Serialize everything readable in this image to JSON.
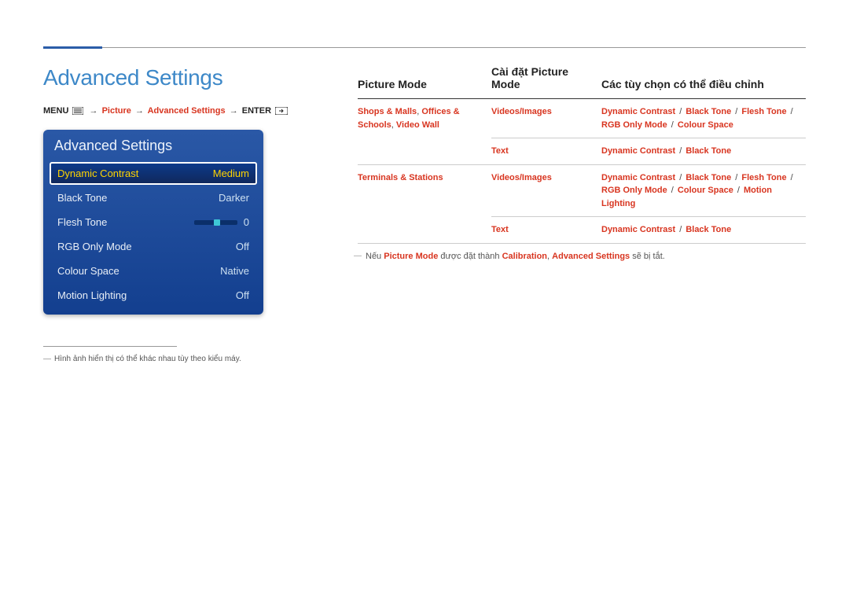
{
  "section_title": "Advanced Settings",
  "breadcrumb": {
    "menu_label": "MENU",
    "picture": "Picture",
    "advanced_settings": "Advanced Settings",
    "enter_label": "ENTER",
    "arrow": "→"
  },
  "osd": {
    "title": "Advanced Settings",
    "items": [
      {
        "label": "Dynamic Contrast",
        "value": "Medium",
        "selected": true,
        "has_slider": false
      },
      {
        "label": "Black Tone",
        "value": "Darker",
        "selected": false,
        "has_slider": false
      },
      {
        "label": "Flesh Tone",
        "value": "0",
        "selected": false,
        "has_slider": true
      },
      {
        "label": "RGB Only Mode",
        "value": "Off",
        "selected": false,
        "has_slider": false
      },
      {
        "label": "Colour Space",
        "value": "Native",
        "selected": false,
        "has_slider": false
      },
      {
        "label": "Motion Lighting",
        "value": "Off",
        "selected": false,
        "has_slider": false
      }
    ]
  },
  "footnote_left": "Hình ảnh hiển thị có thể khác nhau tùy theo kiểu máy.",
  "table": {
    "headers": {
      "picture_mode": "Picture Mode",
      "setting": "Cài đặt Picture Mode",
      "adjustable": "Các tùy chọn có thể điều chỉnh"
    },
    "rows": [
      {
        "picture_mode_parts": [
          "Shops & Malls",
          ", ",
          "Offices & Schools",
          ", ",
          "Video Wall"
        ],
        "rowspan": 2,
        "setting": "Videos/Images",
        "options": [
          "Dynamic Contrast",
          "Black Tone",
          "Flesh Tone",
          "RGB Only Mode",
          "Colour Space"
        ]
      },
      {
        "picture_mode_parts": null,
        "setting": "Text",
        "options": [
          "Dynamic Contrast",
          "Black Tone"
        ]
      },
      {
        "picture_mode_parts": [
          "Terminals & Stations"
        ],
        "rowspan": 2,
        "setting": "Videos/Images",
        "options": [
          "Dynamic Contrast",
          "Black Tone",
          "Flesh Tone",
          "RGB Only Mode",
          "Colour Space",
          "Motion Lighting"
        ]
      },
      {
        "picture_mode_parts": null,
        "setting": "Text",
        "options": [
          "Dynamic Contrast",
          "Black Tone"
        ]
      }
    ]
  },
  "note_right": {
    "prefix": "Nếu ",
    "pm": "Picture Mode",
    "mid1": " được đặt thành ",
    "cal": "Calibration",
    "mid2": ", ",
    "as": "Advanced Settings",
    "suffix": " sẽ bị tắt."
  }
}
